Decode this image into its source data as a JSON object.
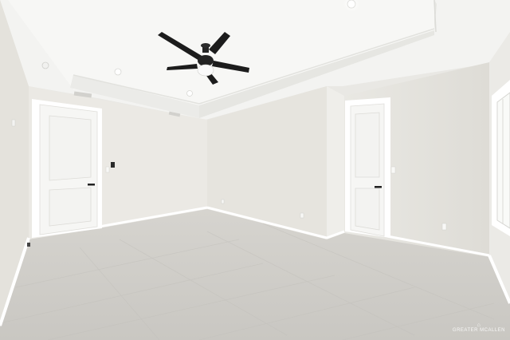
{
  "photo": {
    "subject": "empty-room",
    "watermark": "GREATER MCALLEN",
    "colors": {
      "ceiling": "#f4f4f2",
      "wall_light": "#eceae5",
      "wall_mid": "#e4e2dc",
      "wall_shadow": "#dcdad4",
      "floor": "#cfcdc8",
      "trim": "#ffffff",
      "fan": "#1d1d1d"
    }
  }
}
